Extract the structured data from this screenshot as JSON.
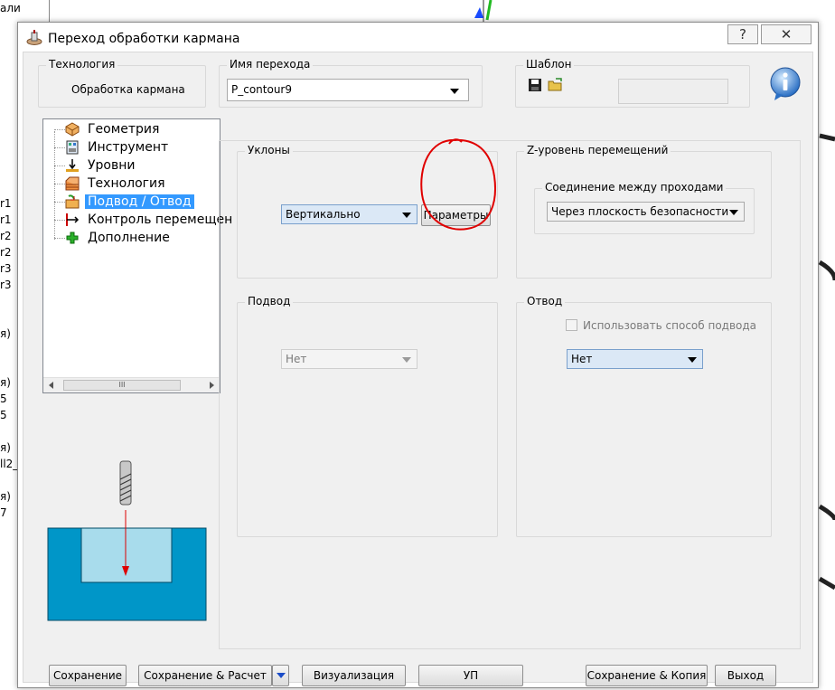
{
  "background": {
    "left_labels": [
      "али",
      "r1",
      "r1",
      "r2",
      "r2",
      "r3",
      "r3",
      "я)",
      "я)",
      "5",
      "5",
      "я)",
      "ll2_",
      "я)",
      "7"
    ]
  },
  "dialog": {
    "title": "Переход обработки кармана",
    "help_label": "?",
    "close_label": "✕"
  },
  "technology": {
    "legend": "Технология",
    "value": "Обработка кармана"
  },
  "step_name": {
    "legend": "Имя перехода",
    "value": "P_contour9"
  },
  "template": {
    "legend": "Шаблон",
    "value": ""
  },
  "tree": {
    "items": [
      {
        "label": "Геометрия",
        "icon": "geometry-icon"
      },
      {
        "label": "Инструмент",
        "icon": "tool-icon"
      },
      {
        "label": "Уровни",
        "icon": "levels-icon"
      },
      {
        "label": "Технология",
        "icon": "technology-icon"
      },
      {
        "label": "Подвод / Отвод",
        "icon": "lead-in-out-icon"
      },
      {
        "label": "Контроль перемещен",
        "icon": "motion-control-icon"
      },
      {
        "label": "Дополнение",
        "icon": "additional-icon"
      }
    ],
    "scroll_thumb": "III"
  },
  "slopes": {
    "legend": "Уклоны",
    "mode_value": "Вертикально",
    "params_label": "Параметры"
  },
  "z_level": {
    "legend": "Z-уровень перемещений",
    "sub_legend": "Соединение между проходами",
    "value": "Через плоскость безопасности"
  },
  "approach": {
    "legend": "Подвод",
    "value": "Нет"
  },
  "retract": {
    "legend": "Отвод",
    "checkbox_label": "Использовать способ подвода",
    "value": "Нет"
  },
  "buttons": {
    "save": "Сохранение",
    "save_calc": "Сохранение & Расчет",
    "visualize": "Визуализация",
    "nc": "УП",
    "save_copy": "Сохранение & Копия",
    "exit": "Выход"
  },
  "colors": {
    "selection": "#3399ff",
    "annotation": "#e00000",
    "preview_block": "#0096c8",
    "preview_pocket": "#a8dcec"
  }
}
